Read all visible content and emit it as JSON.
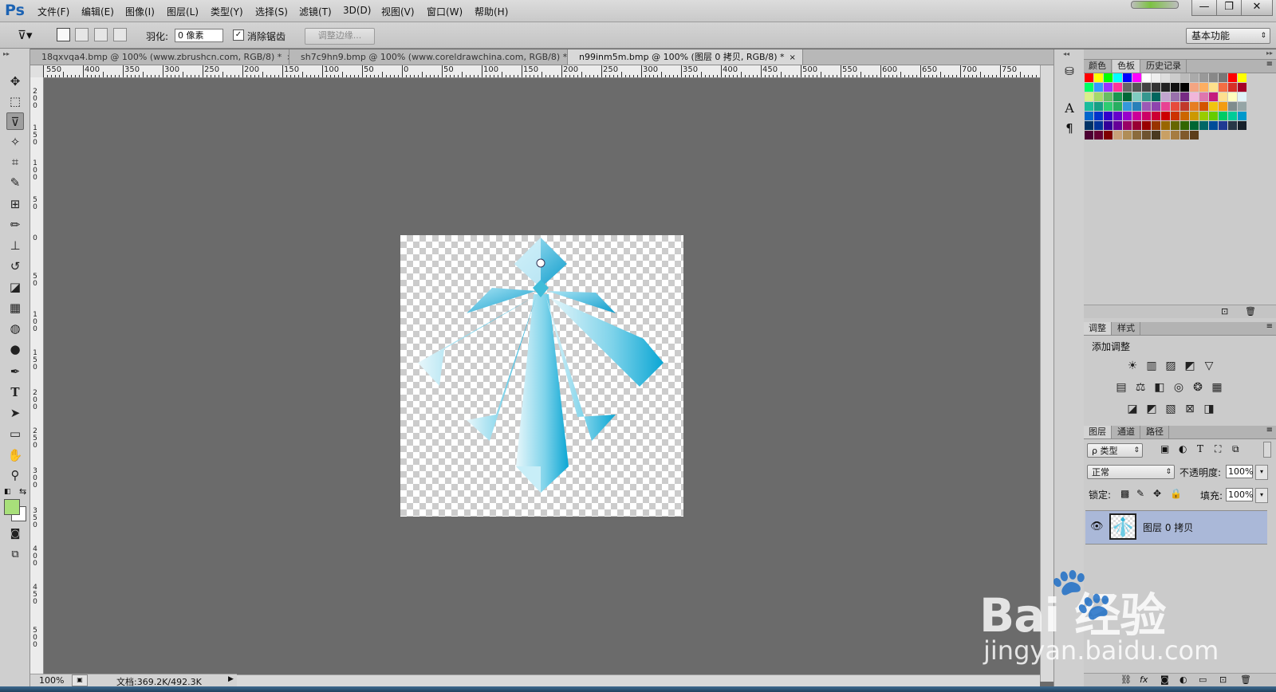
{
  "app": {
    "logo": "Ps"
  },
  "menu": [
    "文件(F)",
    "编辑(E)",
    "图像(I)",
    "图层(L)",
    "类型(Y)",
    "选择(S)",
    "滤镜(T)",
    "3D(D)",
    "视图(V)",
    "窗口(W)",
    "帮助(H)"
  ],
  "window_controls": {
    "minimize": "—",
    "restore": "❐",
    "close": "✕"
  },
  "options": {
    "feather_label": "羽化:",
    "feather_value": "0 像素",
    "antialias_label": "消除锯齿",
    "refine_label": "调整边缘...",
    "workspace_value": "基本功能"
  },
  "tabs": [
    {
      "label": "18qxvqa4.bmp @ 100% (www.zbrushcn.com, RGB/8) *",
      "close": "×"
    },
    {
      "label": "sh7c9hn9.bmp @ 100% (www.coreldrawchina.com, RGB/8) *",
      "close": "×"
    },
    {
      "label": "n99inm5m.bmp @ 100% (图层 0 拷贝, RGB/8) *",
      "close": "×"
    }
  ],
  "ruler_h": [
    "550",
    "400",
    "350",
    "300",
    "250",
    "200",
    "150",
    "100",
    "50",
    "0",
    "50",
    "100",
    "150",
    "200",
    "250",
    "300",
    "350",
    "400",
    "450",
    "500",
    "550",
    "600",
    "650",
    "700",
    "750"
  ],
  "ruler_v": [
    "200",
    "150",
    "100",
    "50",
    "0",
    "50",
    "100",
    "150",
    "200",
    "250",
    "300",
    "350",
    "400",
    "450",
    "500"
  ],
  "status": {
    "zoom": "100%",
    "doc": "文档:369.2K/492.3K"
  },
  "panels": {
    "color_tabs": [
      "颜色",
      "色板",
      "历史记录"
    ],
    "adjust_tabs": [
      "调整",
      "样式"
    ],
    "adjust_title": "添加调整",
    "layer_tabs": [
      "图层",
      "通道",
      "路径"
    ],
    "kind_label": "ρ 类型",
    "blend_mode": "正常",
    "opacity_label": "不透明度:",
    "opacity_value": "100%",
    "lock_label": "锁定:",
    "fill_label": "填充:",
    "fill_value": "100%",
    "layer_name": "图层 0 拷贝"
  },
  "colors": {
    "accent_fg": "#a8e07a",
    "selected_layer_bg": "#aab8d8",
    "canvas_bg": "#6b6b6b"
  },
  "watermark": {
    "brand": "Bai 经验",
    "url": "jingyan.baidu.com"
  }
}
